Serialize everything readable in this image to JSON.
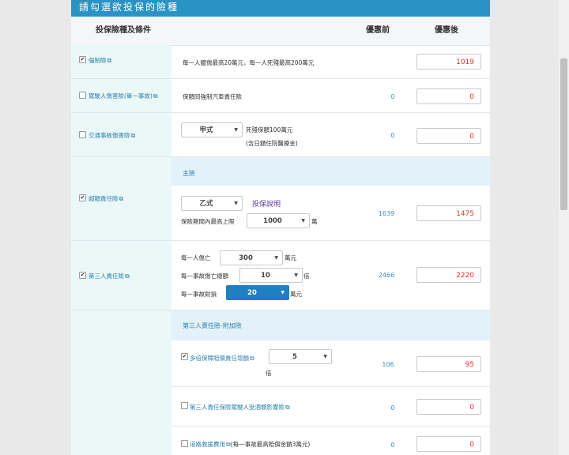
{
  "title": "請勾選欲投保的險種",
  "header": {
    "col1": "投保險種及條件",
    "col2": "優惠前",
    "col3": "優惠後"
  },
  "rows": {
    "compulsory": {
      "label": "強制險",
      "desc": "每一人體傷最高20萬元，每一人死殘最高200萬元",
      "before": "",
      "after": "1019",
      "checked": true
    },
    "driver": {
      "label": "駕駛人傷害險(單一事故)",
      "desc": "保額同強制汽車責任險",
      "before": "0",
      "after": "0",
      "checked": false
    },
    "accident": {
      "label": "交通事故傷害險",
      "select": "甲式",
      "desc1": "死殘保額100萬元",
      "desc2": "(含日額住院醫療金)",
      "before": "0",
      "after": "0",
      "checked": false
    },
    "excess": {
      "label": "超額責任險",
      "select": "乙式",
      "link": "投保說明",
      "limit_label": "保險期間內最高上限",
      "limit_select": "1000",
      "limit_unit": "萬",
      "before": "1639",
      "after": "1475",
      "checked": true
    },
    "third_party": {
      "label": "第三人責任險",
      "line1_label": "每一人傷亡",
      "line1_select": "300",
      "line1_unit": "萬元",
      "line2_label": "每一事故傷亡總額",
      "line2_select": "10",
      "line2_unit": "倍",
      "line3_label": "每一事故財損",
      "line3_select": "20",
      "line3_unit": "萬元",
      "before": "2466",
      "after": "2220",
      "checked": true
    },
    "multiple": {
      "label": "多倍保障賠償責任增額",
      "select": "5",
      "unit": "倍",
      "before": "106",
      "after": "95",
      "checked": true
    },
    "drunk": {
      "label": "第三人責任保險駕駛人受酒類影響險",
      "before": "0",
      "after": "0",
      "checked": false
    },
    "rescue": {
      "label": "道路救援費用",
      "note": "(每一事故最高賠償金額3萬元)",
      "before": "0",
      "after": "0",
      "checked": false
    }
  },
  "bands": {
    "main": "主險",
    "addon": "第三人責任險-附加險"
  },
  "ext_icon": "external-link-icon",
  "colors": {
    "brand": "#2a93c6",
    "link": "#2b7fb0",
    "price": "#d9352c",
    "band": "#e2f2f8",
    "leftcol": "#eaf8f8"
  }
}
